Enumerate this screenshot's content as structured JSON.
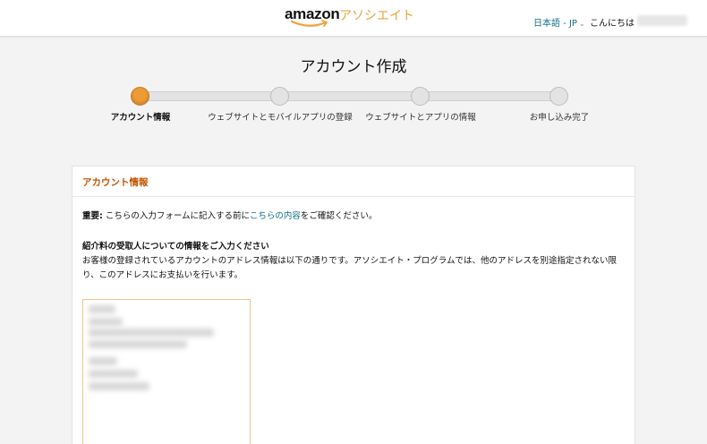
{
  "header": {
    "logo_amazon": "amazon",
    "logo_associates": "アソシエイト",
    "language": "日本語 - JP",
    "greeting": "こんにちは"
  },
  "page": {
    "title": "アカウント作成"
  },
  "steps": [
    {
      "label": "アカウント情報",
      "active": true
    },
    {
      "label": "ウェブサイトとモバイルアプリの登録",
      "active": false
    },
    {
      "label": "ウェブサイトとアプリの情報",
      "active": false
    },
    {
      "label": "お申し込み完了",
      "active": false
    }
  ],
  "card": {
    "heading": "アカウント情報",
    "notice_bold": "重要:",
    "notice_text": " こちらの入力フォームに記入する前に",
    "notice_link": "こちらの内容",
    "notice_tail": "をご確認ください。",
    "payee_heading": "紹介料の受取人についての情報をご入力ください",
    "payee_desc": "お客様の登録されているアカウントのアドレス情報は以下の通りです。アソシエイト・プログラムでは、他のアドレスを別途指定されない限り、このアドレスにお支払いを行います。"
  },
  "colors": {
    "accent_orange": "#ec9b36",
    "heading_orange": "#c45500",
    "link_teal": "#0f6f8a"
  }
}
